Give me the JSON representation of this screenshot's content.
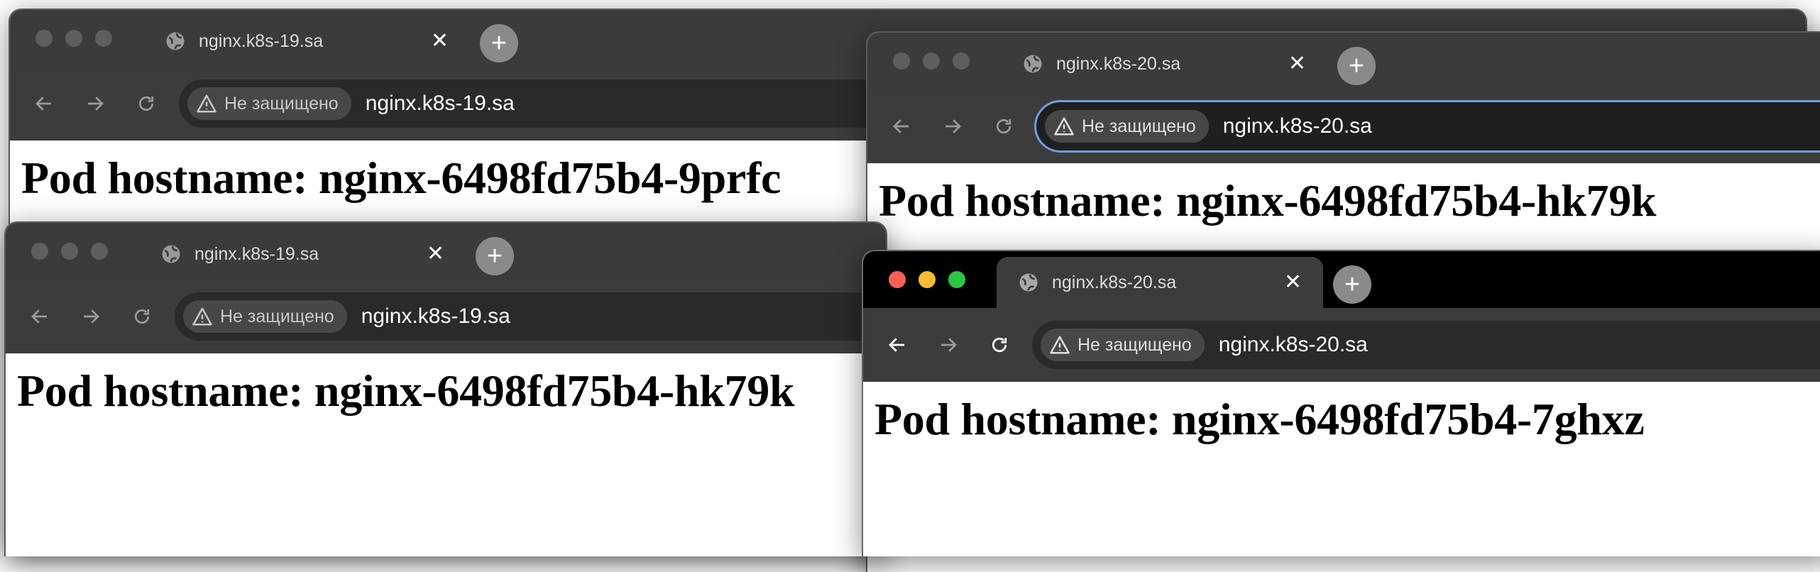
{
  "colors": {
    "accent_focus": "#6d9eeb",
    "tabbar": "#3b3b3d",
    "toolbar": "#3c3c3c"
  },
  "icons": {
    "tab_icon": "globe-icon",
    "warning": "warning-triangle-icon",
    "back": "arrow-left-icon",
    "forward": "arrow-right-icon",
    "reload": "reload-icon",
    "close": "close-icon",
    "new_tab": "plus-icon"
  },
  "windows": [
    {
      "tab": {
        "title": "nginx.k8s-19.sa",
        "close": "✕",
        "new_tab": "+"
      },
      "omnibox": {
        "security_label": "Не защищено",
        "url": "nginx.k8s-19.sa"
      },
      "page": {
        "heading": "Pod hostname: nginx-6498fd75b4-9prfc"
      }
    },
    {
      "tab": {
        "title": "nginx.k8s-20.sa",
        "close": "✕",
        "new_tab": "+"
      },
      "omnibox": {
        "security_label": "Не защищено",
        "url": "nginx.k8s-20.sa"
      },
      "page": {
        "heading": "Pod hostname: nginx-6498fd75b4-hk79k"
      }
    },
    {
      "tab": {
        "title": "nginx.k8s-19.sa",
        "close": "✕",
        "new_tab": "+"
      },
      "omnibox": {
        "security_label": "Не защищено",
        "url": "nginx.k8s-19.sa"
      },
      "page": {
        "heading": "Pod hostname: nginx-6498fd75b4-hk79k"
      }
    },
    {
      "tab": {
        "title": "nginx.k8s-20.sa",
        "close": "✕",
        "new_tab": "+"
      },
      "omnibox": {
        "security_label": "Не защищено",
        "url": "nginx.k8s-20.sa"
      },
      "page": {
        "heading": "Pod hostname: nginx-6498fd75b4-7ghxz"
      }
    }
  ]
}
